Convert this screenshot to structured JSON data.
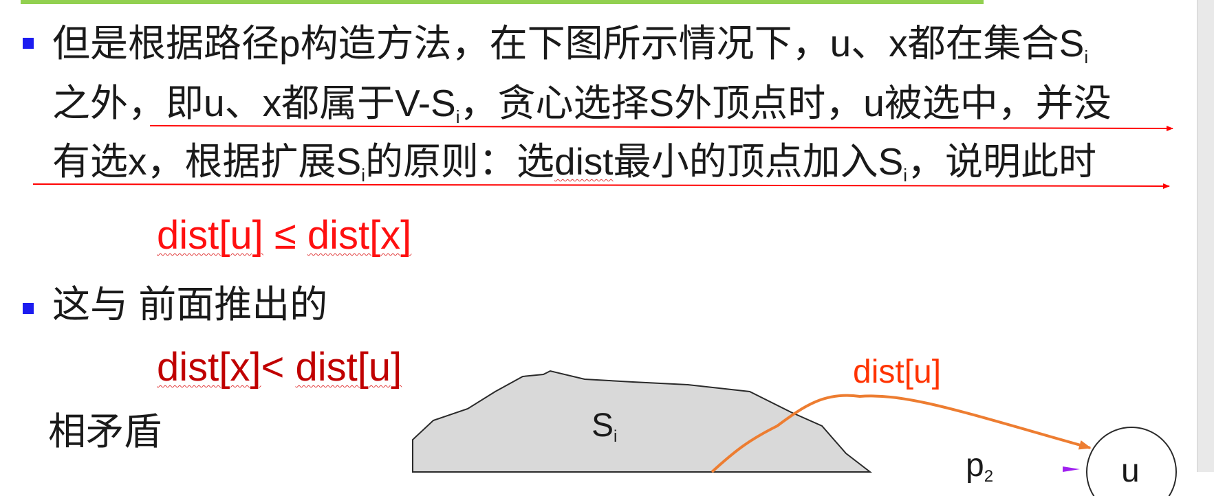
{
  "slide": {
    "bullet1": {
      "line1_pre": "但是根据路径p构造方法，在下图所示情况下，u、x都在集合S",
      "line1_sub": "i",
      "line2_pre": "之外，即u、x都属于V-S",
      "line2_sub": "i",
      "line2_post": "，贪心选择S外顶点时，u被选中，并没",
      "line3_pre": "有选x，根据扩展S",
      "line3_sub": "i",
      "line3_mid1": "的原则：选",
      "line3_dist": "dist",
      "line3_mid2": "最小的顶点加入S",
      "line3_sub2": "i",
      "line3_post": "，说明此时"
    },
    "formula1": {
      "left": "dist[u]",
      "op": " ≤ ",
      "right": "dist[x]"
    },
    "bullet2": {
      "text": "这与 前面推出的"
    },
    "formula2": {
      "left": "dist[x]",
      "op": "< ",
      "right": "dist[u]"
    },
    "conclusion": "相矛盾"
  },
  "figure": {
    "set_label": "S",
    "set_sub": "i",
    "curve_label": "dist[u]",
    "path_label": "p",
    "path_sub": "2",
    "node_label": "u"
  },
  "colors": {
    "accent_rule": "#92d050",
    "bullet": "#1c1cf0",
    "formula1": "#ff1010",
    "formula2": "#c00000",
    "curve": "#ed7d31",
    "annotation_lines": "#ff0000",
    "set_fill": "#d9d9d9"
  }
}
